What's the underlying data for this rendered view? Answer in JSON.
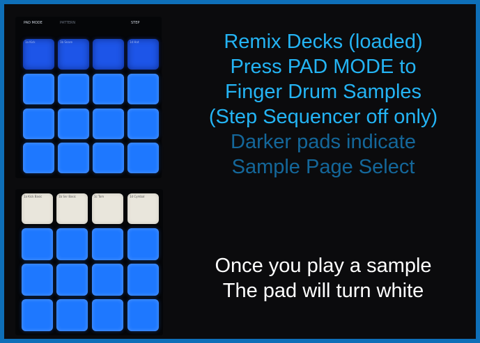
{
  "colors": {
    "border": "#0e6fb8",
    "background": "#0b0b0d",
    "bright_text": "#24b4f4",
    "dim_text": "#14679a",
    "white_text": "#ffffff",
    "pad_blue": "#1e78ff",
    "pad_dark_blue": "#1d55e8",
    "pad_white": "#e9e6dc"
  },
  "top_panel": {
    "labels": [
      "PAD MODE",
      "PATTERN",
      "STEP"
    ],
    "pad_labels": [
      "1a Kick",
      "1b Snare",
      "",
      "1d Hat",
      "",
      "",
      "",
      "",
      "",
      "",
      "",
      "",
      "",
      "",
      "",
      ""
    ]
  },
  "bottom_panel": {
    "pad_labels": [
      "1a Kick Basic",
      "1b Snr Basic",
      "1c Tom",
      "1d Cymbal"
    ]
  },
  "instructions": {
    "lines_bright": [
      "Remix Decks (loaded)",
      "Press PAD MODE to",
      "Finger Drum Samples",
      "(Step Sequencer off only)"
    ],
    "lines_dim": [
      "Darker pads indicate",
      "Sample Page Select"
    ],
    "lines_white": [
      "Once you play a sample",
      "The pad will turn white"
    ]
  }
}
